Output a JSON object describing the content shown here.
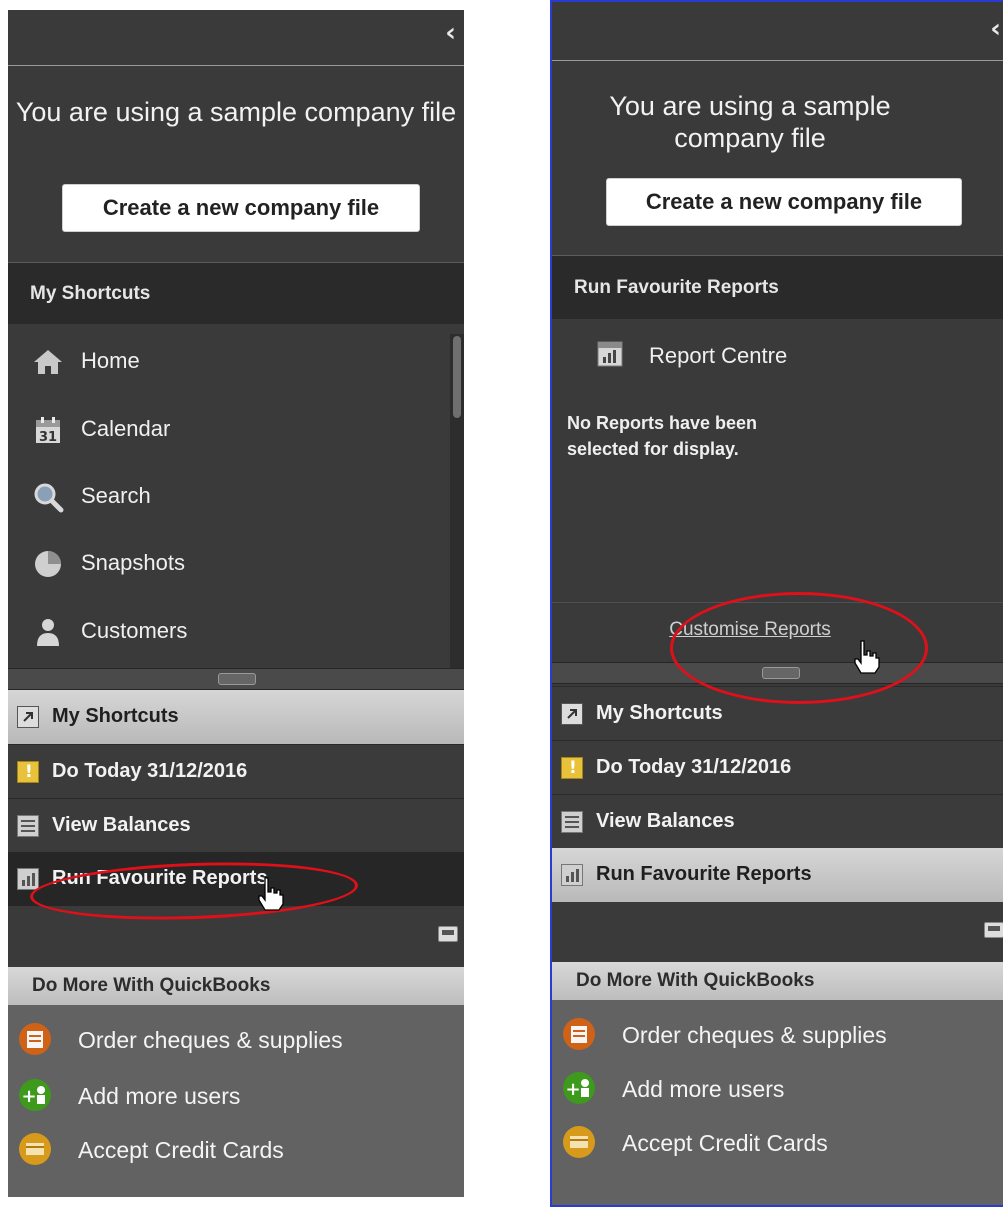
{
  "left_panel": {
    "sample_text": "You are using a sample company file",
    "create_button": "Create a new company file",
    "shortcuts_header": "My Shortcuts",
    "shortcut_items": [
      {
        "label": "Home",
        "icon": "home-icon"
      },
      {
        "label": "Calendar",
        "icon": "calendar-icon"
      },
      {
        "label": "Search",
        "icon": "search-icon"
      },
      {
        "label": "Snapshots",
        "icon": "pie-chart-icon"
      },
      {
        "label": "Customers",
        "icon": "person-icon"
      }
    ],
    "nav_rows": [
      {
        "label": "My Shortcuts",
        "icon": "shortcut-arrow-icon"
      },
      {
        "label": "Do Today 31/12/2016",
        "icon": "exclamation-icon"
      },
      {
        "label": "View Balances",
        "icon": "balances-icon"
      },
      {
        "label": "Run Favourite Reports",
        "icon": "report-icon"
      }
    ],
    "do_more_header": "Do More With QuickBooks",
    "promos": [
      {
        "label": "Order cheques & supplies",
        "icon": "cheque-icon",
        "color": "#d06218"
      },
      {
        "label": "Add more users",
        "icon": "add-user-icon",
        "color": "#3d9a1c"
      },
      {
        "label": "Accept Credit Cards",
        "icon": "credit-card-icon",
        "color": "#d79a1a"
      }
    ]
  },
  "right_panel": {
    "sample_text": "You are using a sample company file",
    "create_button": "Create a new company file",
    "reports_header": "Run Favourite Reports",
    "report_centre": "Report Centre",
    "no_reports": "No Reports have been selected for display.",
    "customise_link": "Customise Reports",
    "nav_rows": [
      {
        "label": "My Shortcuts",
        "icon": "shortcut-arrow-icon"
      },
      {
        "label": "Do Today 31/12/2016",
        "icon": "exclamation-icon"
      },
      {
        "label": "View Balances",
        "icon": "balances-icon"
      },
      {
        "label": "Run Favourite Reports",
        "icon": "report-icon"
      }
    ],
    "do_more_header": "Do More With QuickBooks",
    "promos": [
      {
        "label": "Order cheques & supplies",
        "icon": "cheque-icon",
        "color": "#d06218"
      },
      {
        "label": "Add more users",
        "icon": "add-user-icon",
        "color": "#3d9a1c"
      },
      {
        "label": "Accept Credit Cards",
        "icon": "credit-card-icon",
        "color": "#d79a1a"
      }
    ]
  },
  "colors": {
    "panel_bg": "#3a3a3a",
    "highlight_ring": "#e0101a",
    "frame_border": "#2a3bd0"
  }
}
